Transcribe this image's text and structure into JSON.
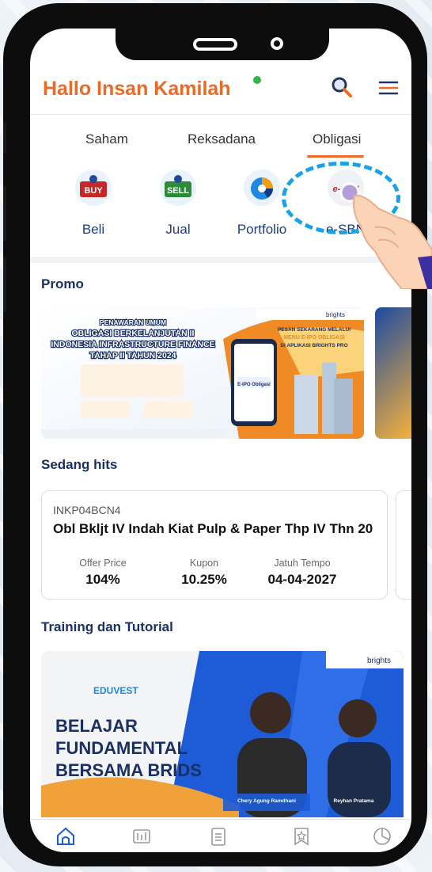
{
  "header": {
    "greeting": "Hallo Insan Kamilah"
  },
  "tabs": [
    {
      "label": "Saham"
    },
    {
      "label": "Reksadana"
    },
    {
      "label": "Obligasi",
      "active": true
    }
  ],
  "quick_actions": [
    {
      "label": "Beli",
      "icon": "buy-icon",
      "icon_text": "BUY"
    },
    {
      "label": "Jual",
      "icon": "sell-icon",
      "icon_text": "SELL"
    },
    {
      "label": "Portfolio",
      "icon": "portfolio-pie-icon"
    },
    {
      "label": "e-SBN",
      "icon": "esbn-logo",
      "icon_text": "e-SBN"
    }
  ],
  "promo": {
    "title": "Promo",
    "banner": {
      "headline": "PENAWARAN UMUM\nOBLIGASI BERKELANJUTAN II\nINDONESIA INFRASTRUCTURE FINANCE\nTAHAP II TAHUN 2024",
      "cta": "PESAN SEKARANG MELALUI\nMENU E-IPO OBLIGASI\nDI APLIKASI BRIGHTS PRO",
      "app_label": "E-IPO Obligasi",
      "brand": "brights"
    }
  },
  "hits": {
    "title": "Sedang hits",
    "card": {
      "code": "INKP04BCN4",
      "name": "Obl Bkljt IV Indah Kiat Pulp & Paper Thp IV Thn 20",
      "stats": [
        {
          "label": "Offer Price",
          "value": "104%"
        },
        {
          "label": "Kupon",
          "value": "10.25%"
        },
        {
          "label": "Jatuh Tempo",
          "value": "04-04-2027"
        }
      ]
    }
  },
  "training": {
    "title": "Training dan Tutorial",
    "banner": {
      "brand": "brights",
      "series": "EDUVEST",
      "headline_1": "BELAJAR",
      "headline_2": "FUNDAMENTAL",
      "headline_3": "BERSAMA BRIDS",
      "speaker_1": "Chery Agung Ramdhani",
      "speaker_2": "Reyhan Pratama"
    }
  },
  "nav": [
    "home-icon",
    "market-icon",
    "orders-icon",
    "watchlist-icon",
    "portfolio-icon"
  ],
  "colors": {
    "accent": "#ea6a27",
    "navy": "#1a2f66",
    "highlight": "#1aa2e8"
  }
}
